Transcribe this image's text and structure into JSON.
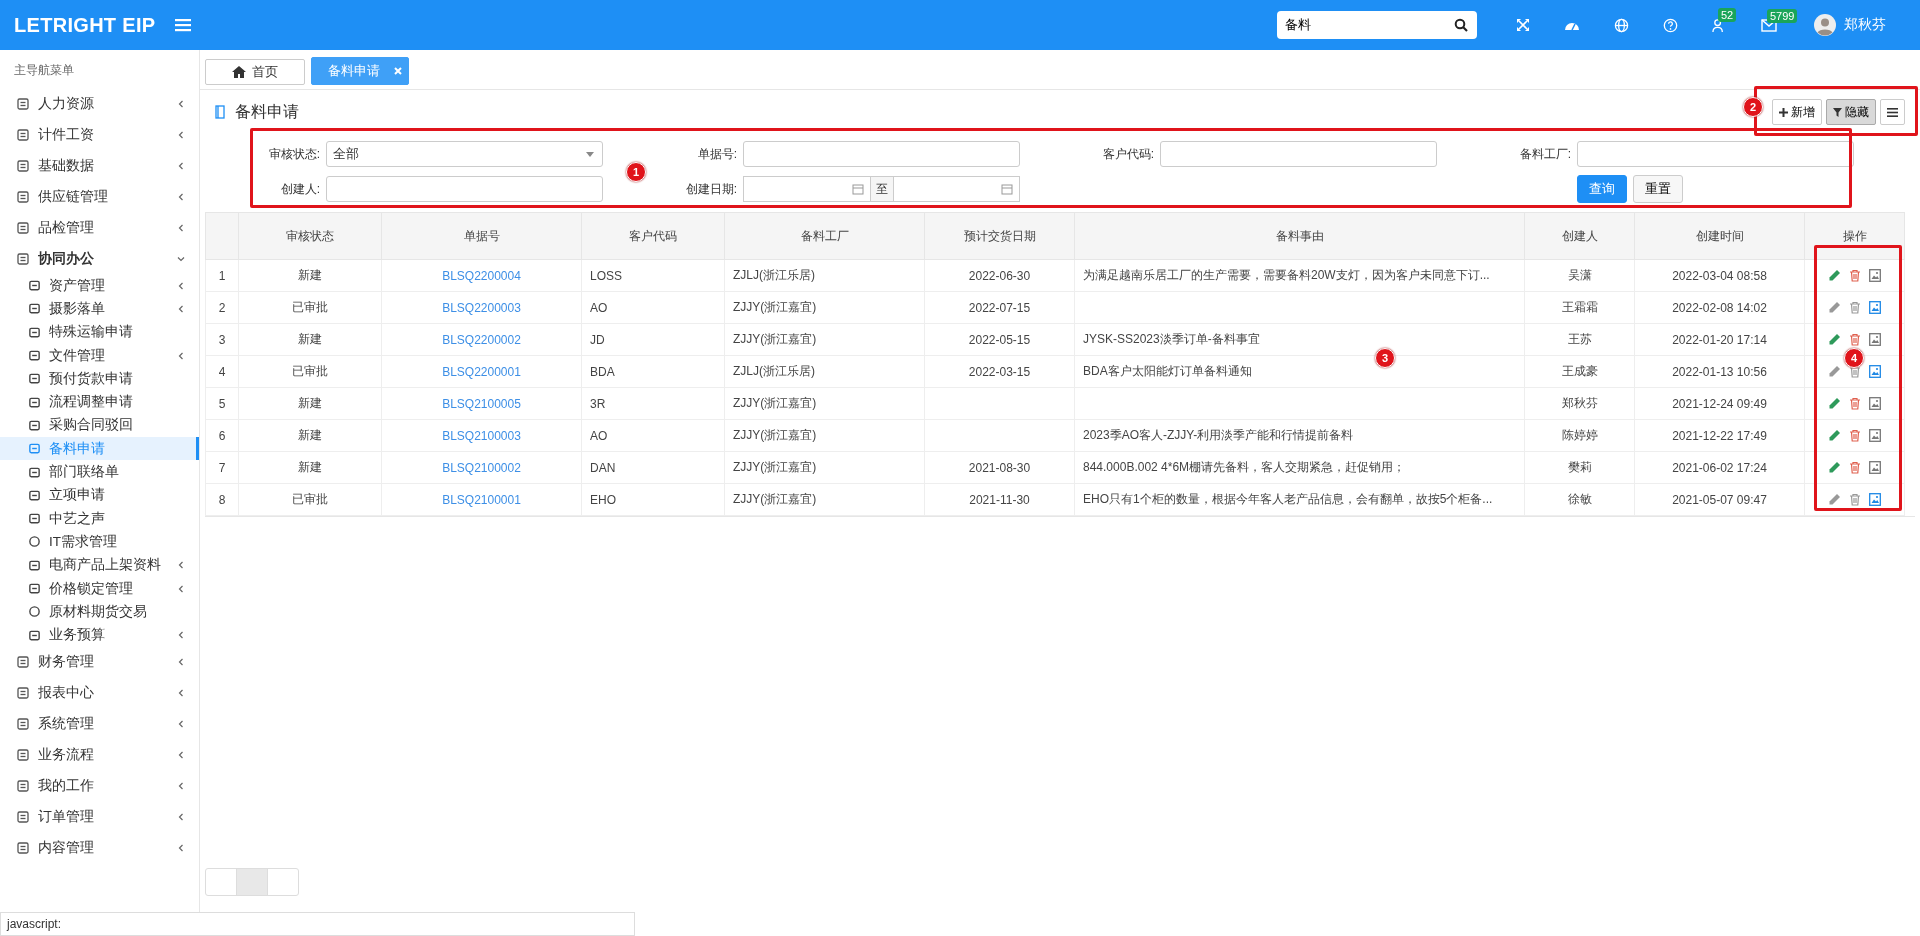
{
  "header": {
    "logo": "LETRIGHT EIP",
    "search": {
      "value": "备料"
    },
    "badges": [
      "52",
      "5799"
    ],
    "user": "郑秋芬"
  },
  "sidebar": {
    "title": "主导航菜单",
    "items": [
      {
        "label": "人力资源",
        "expanded": false,
        "selected": false
      },
      {
        "label": "计件工资",
        "expanded": false,
        "selected": false
      },
      {
        "label": "基础数据",
        "expanded": false,
        "selected": false
      },
      {
        "label": "供应链管理",
        "expanded": false,
        "selected": false
      },
      {
        "label": "品检管理",
        "expanded": false,
        "selected": false
      },
      {
        "label": "协同办公",
        "expanded": true,
        "selected": false,
        "children": [
          {
            "label": "资产管理",
            "has_children": true,
            "selected": false
          },
          {
            "label": "摄影落单",
            "has_children": true,
            "selected": false
          },
          {
            "label": "特殊运输申请",
            "has_children": false,
            "selected": false
          },
          {
            "label": "文件管理",
            "has_children": true,
            "selected": false
          },
          {
            "label": "预付货款申请",
            "has_children": false,
            "selected": false
          },
          {
            "label": "流程调整申请",
            "has_children": false,
            "selected": false
          },
          {
            "label": "采购合同驳回",
            "has_children": false,
            "selected": false
          },
          {
            "label": "备料申请",
            "has_children": false,
            "selected": true
          },
          {
            "label": "部门联络单",
            "has_children": false,
            "selected": false
          },
          {
            "label": "立项申请",
            "has_children": false,
            "selected": false
          },
          {
            "label": "中艺之声",
            "has_children": false,
            "selected": false
          },
          {
            "label": "IT需求管理",
            "has_children": false,
            "selected": false
          },
          {
            "label": "电商产品上架资料",
            "has_children": true,
            "selected": false
          },
          {
            "label": "价格锁定管理",
            "has_children": true,
            "selected": false
          },
          {
            "label": "原材料期货交易",
            "has_children": false,
            "selected": false
          },
          {
            "label": "业务预算",
            "has_children": true,
            "selected": false
          }
        ]
      },
      {
        "label": "财务管理",
        "expanded": false,
        "selected": false
      },
      {
        "label": "报表中心",
        "expanded": false,
        "selected": false
      },
      {
        "label": "系统管理",
        "expanded": false,
        "selected": false
      },
      {
        "label": "业务流程",
        "expanded": false,
        "selected": false
      },
      {
        "label": "我的工作",
        "expanded": false,
        "selected": false
      },
      {
        "label": "订单管理",
        "expanded": false,
        "selected": false
      },
      {
        "label": "内容管理",
        "expanded": false,
        "selected": false
      }
    ]
  },
  "tabs": [
    {
      "label": "首页",
      "selected": false,
      "closable": false
    },
    {
      "label": "备料申请",
      "selected": true,
      "closable": true
    }
  ],
  "page": {
    "title": "备料申请",
    "toolbar": [
      {
        "label": "新增",
        "kind": "add",
        "pressed": false
      },
      {
        "label": "隐藏",
        "kind": "filter",
        "pressed": true
      },
      {
        "kind": "menu",
        "pressed": false
      }
    ]
  },
  "filters": {
    "status": {
      "label": "审核状态:",
      "value": "全部"
    },
    "code": {
      "label": "单据号:"
    },
    "customer": {
      "label": "客户代码:"
    },
    "factory": {
      "label": "备料工厂:"
    },
    "creator": {
      "label": "创建人:"
    },
    "date": {
      "label": "创建日期:",
      "to": "至"
    },
    "buttons": [
      "查询",
      "重置"
    ]
  },
  "table": {
    "columns": [
      "审核状态",
      "单据号",
      "客户代码",
      "备料工厂",
      "预计交货日期",
      "备料事由",
      "创建人",
      "创建时间",
      "操作"
    ],
    "rows": [
      {
        "index": "1",
        "status": "新建",
        "code": "BLSQ2200004",
        "customer": "LOSS",
        "factory": "ZJLJ(浙江乐居)",
        "delivery": "2022-06-30",
        "reason": "为满足越南乐居工厂的生产需要，需要备料20W支灯，因为客户未同意下订...",
        "creator": "吴潇",
        "created": "2022-03-04 08:58",
        "editable": true
      },
      {
        "index": "2",
        "status": "已审批",
        "code": "BLSQ2200003",
        "customer": "AO",
        "factory": "ZJJY(浙江嘉宜)",
        "delivery": "2022-07-15",
        "reason": "",
        "creator": "王霜霜",
        "created": "2022-02-08 14:02",
        "editable": false
      },
      {
        "index": "3",
        "status": "新建",
        "code": "BLSQ2200002",
        "customer": "JD",
        "factory": "ZJJY(浙江嘉宜)",
        "delivery": "2022-05-15",
        "reason": "JYSK-SS2023淡季订单-备料事宜",
        "creator": "王苏",
        "created": "2022-01-20 17:14",
        "editable": true
      },
      {
        "index": "4",
        "status": "已审批",
        "code": "BLSQ2200001",
        "customer": "BDA",
        "factory": "ZJLJ(浙江乐居)",
        "delivery": "2022-03-15",
        "reason": "BDA客户太阳能灯订单备料通知",
        "creator": "王成豪",
        "created": "2022-01-13 10:56",
        "editable": false
      },
      {
        "index": "5",
        "status": "新建",
        "code": "BLSQ2100005",
        "customer": "3R",
        "factory": "ZJJY(浙江嘉宜)",
        "delivery": "",
        "reason": "",
        "creator": "郑秋芬",
        "created": "2021-12-24 09:49",
        "editable": true
      },
      {
        "index": "6",
        "status": "新建",
        "code": "BLSQ2100003",
        "customer": "AO",
        "factory": "ZJJY(浙江嘉宜)",
        "delivery": "",
        "reason": "2023季AO客人-ZJJY-利用淡季产能和行情提前备料",
        "creator": "陈婷婷",
        "created": "2021-12-22 17:49",
        "editable": true
      },
      {
        "index": "7",
        "status": "新建",
        "code": "BLSQ2100002",
        "customer": "DAN",
        "factory": "ZJJY(浙江嘉宜)",
        "delivery": "2021-08-30",
        "reason": "844.000B.002 4*6M棚请先备料，客人交期紧急，赶促销用；",
        "creator": "樊莉",
        "created": "2021-06-02 17:24",
        "editable": true
      },
      {
        "index": "8",
        "status": "已审批",
        "code": "BLSQ2100001",
        "customer": "EHO",
        "factory": "ZJJY(浙江嘉宜)",
        "delivery": "2021-11-30",
        "reason": "EHO只有1个柜的数量，根据今年客人老产品信息，会有翻单，故按5个柜备...",
        "creator": "徐敏",
        "created": "2021-05-07 09:47",
        "editable": false
      }
    ]
  },
  "annotations": [
    {
      "label": "1",
      "framed": true
    },
    {
      "label": "2",
      "framed": true
    },
    {
      "label": "3",
      "framed": false
    },
    {
      "label": "4",
      "framed": true
    }
  ],
  "status_bar": "javascript:"
}
